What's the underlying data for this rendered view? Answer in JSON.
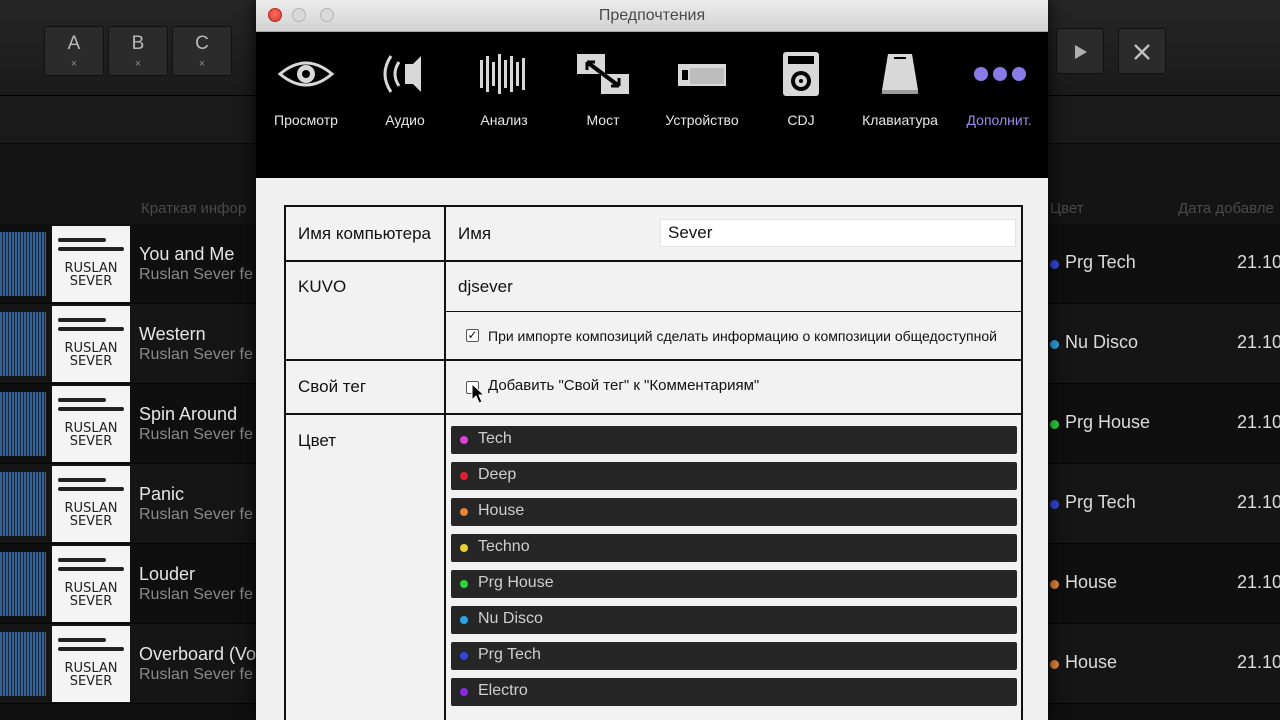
{
  "top_bar": {
    "slots": [
      {
        "label": "A",
        "close": "×"
      },
      {
        "label": "B",
        "close": "×"
      },
      {
        "label": "C",
        "close": "×"
      }
    ],
    "play_icon": "play-icon",
    "close_icon": "close-icon"
  },
  "columns": {
    "info_partial": "Краткая инфор",
    "color": "Цвет",
    "date_partial": "Дата добавле"
  },
  "tracks": [
    {
      "title": "You and Me",
      "artist": "Ruslan Sever fe",
      "color_label": "Prg Tech",
      "color_hex": "#3248e0",
      "date": "21.10"
    },
    {
      "title": "Western",
      "artist": "Ruslan Sever fe",
      "color_label": "Nu Disco",
      "color_hex": "#2aa6e8",
      "date": "21.10"
    },
    {
      "title": "Spin Around",
      "artist": "Ruslan Sever fe",
      "color_label": "Prg House",
      "color_hex": "#2ed63a",
      "date": "21.10"
    },
    {
      "title": "Panic",
      "artist": "Ruslan Sever fe",
      "color_label": "Prg Tech",
      "color_hex": "#3248e0",
      "date": "21.10"
    },
    {
      "title": "Louder",
      "artist": "Ruslan Sever fe",
      "color_label": "House",
      "color_hex": "#e8873a",
      "date": "21.10"
    },
    {
      "title": "Overboard (Vo",
      "artist": "Ruslan Sever fe",
      "color_label": "House",
      "color_hex": "#e8873a",
      "date": "21.10"
    }
  ],
  "thumb_logo": {
    "line1": "RUSLAN",
    "line2": "SEVER"
  },
  "dialog": {
    "title": "Предпочтения",
    "tabs": [
      {
        "label": "Просмотр",
        "icon": "eye-icon"
      },
      {
        "label": "Аудио",
        "icon": "speaker-icon"
      },
      {
        "label": "Анализ",
        "icon": "waveform-icon"
      },
      {
        "label": "Мост",
        "icon": "bridge-icon"
      },
      {
        "label": "Устройство",
        "icon": "device-icon"
      },
      {
        "label": "CDJ",
        "icon": "cdj-icon"
      },
      {
        "label": "Клавиатура",
        "icon": "keyboard-icon"
      },
      {
        "label": "Дополнит.",
        "icon": "more-dots-icon",
        "active": true
      }
    ],
    "rows": {
      "computer_name": {
        "label": "Имя компьютера",
        "field_label": "Имя",
        "value": "Sever"
      },
      "kuvo": {
        "label": "KUVO",
        "account": "djsever",
        "checkbox_text": "При импорте композиций сделать информацию о композиции общедоступной",
        "checked": true
      },
      "my_tag": {
        "label": "Свой тег",
        "checkbox_text": "Добавить  \"Свой тег\" к  \"Комментариям\"",
        "checked": false
      },
      "color": {
        "label": "Цвет"
      }
    },
    "colors": [
      {
        "name": "Tech",
        "hex": "#e040d8"
      },
      {
        "name": "Deep",
        "hex": "#e02030"
      },
      {
        "name": "House",
        "hex": "#e8873a"
      },
      {
        "name": "Techno",
        "hex": "#e8d030"
      },
      {
        "name": "Prg House",
        "hex": "#2ed63a"
      },
      {
        "name": "Nu Disco",
        "hex": "#2aa6e8"
      },
      {
        "name": "Prg Tech",
        "hex": "#3248e0"
      },
      {
        "name": "Electro",
        "hex": "#8a2ae0"
      }
    ]
  }
}
